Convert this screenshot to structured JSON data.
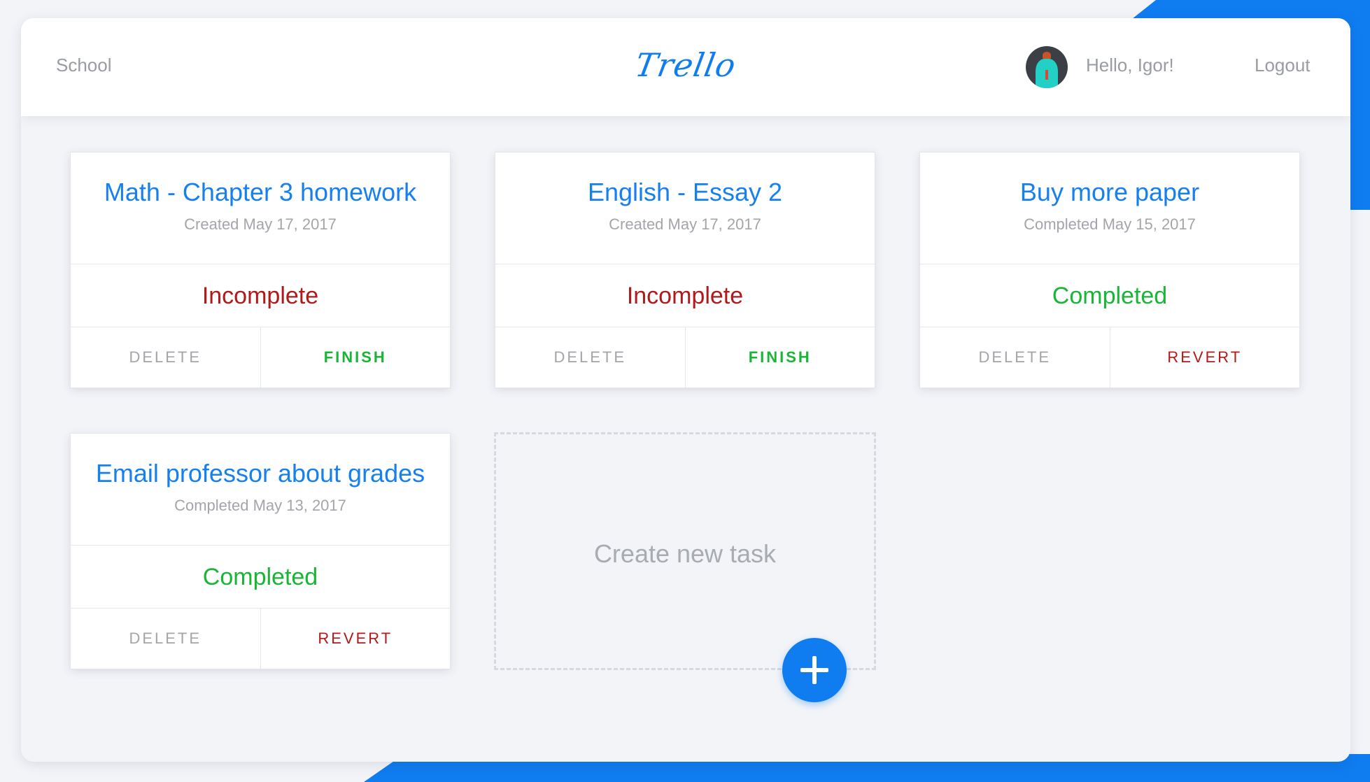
{
  "header": {
    "board_name": "School",
    "logo_text": "Trello",
    "greeting": "Hello, Igor!",
    "logout_label": "Logout"
  },
  "tasks": [
    {
      "title": "Math - Chapter 3 homework",
      "date": "Created May 17, 2017",
      "status": "Incomplete",
      "delete_label": "DELETE",
      "action_label": "FINISH"
    },
    {
      "title": "English - Essay 2",
      "date": "Created May 17, 2017",
      "status": "Incomplete",
      "delete_label": "DELETE",
      "action_label": "FINISH"
    },
    {
      "title": "Buy more paper",
      "date": "Completed May 15, 2017",
      "status": "Completed",
      "delete_label": "DELETE",
      "action_label": "REVERT"
    },
    {
      "title": "Email professor about grades",
      "date": "Completed May 13, 2017",
      "status": "Completed",
      "delete_label": "DELETE",
      "action_label": "REVERT"
    }
  ],
  "new_task": {
    "label": "Create new task",
    "add_icon": "plus-icon"
  },
  "colors": {
    "accent": "#0f7cf0",
    "title": "#1680ee",
    "incomplete": "#b01a1a",
    "completed": "#19b536",
    "muted": "#a3a5ab"
  }
}
